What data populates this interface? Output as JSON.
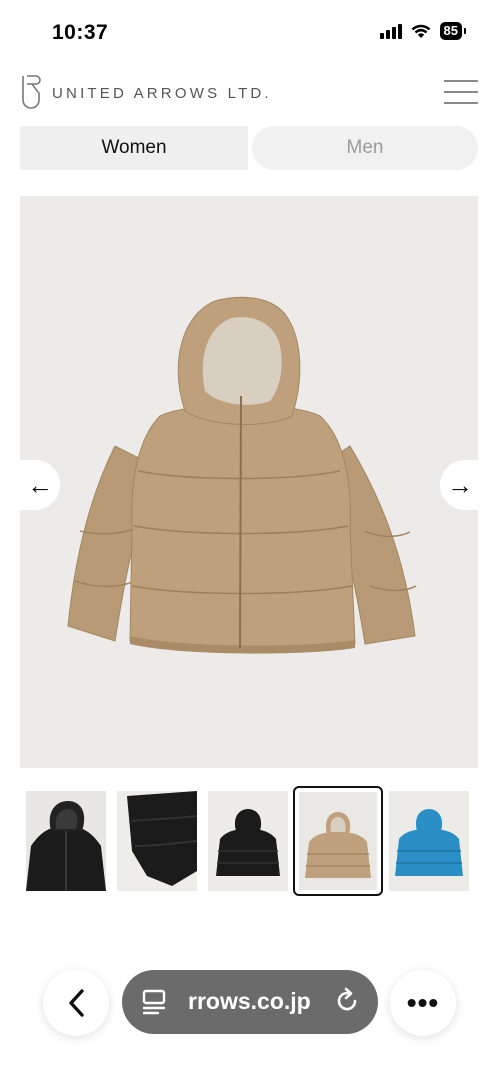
{
  "status_bar": {
    "time": "10:37",
    "battery": "85"
  },
  "header": {
    "brand": "UNITED ARROWS LTD."
  },
  "tabs": [
    {
      "label": "Women",
      "selected": true
    },
    {
      "label": "Men",
      "selected": false
    }
  ],
  "carousel": {
    "prev_label": "←",
    "next_label": "→"
  },
  "product": {
    "color": "#bfa07c"
  },
  "thumbnails": [
    {
      "name": "black hooded jacket front",
      "color": "#1b1b1b"
    },
    {
      "name": "black jacket detail",
      "color": "#1b1b1b"
    },
    {
      "name": "black jacket back",
      "color": "#1b1b1b"
    },
    {
      "name": "beige jacket",
      "color": "#bfa07c",
      "selected": true
    },
    {
      "name": "blue jacket",
      "color": "#2a8fc4"
    }
  ],
  "browser": {
    "url": "rrows.co.jp",
    "back_label": "‹",
    "more_label": "•••"
  }
}
